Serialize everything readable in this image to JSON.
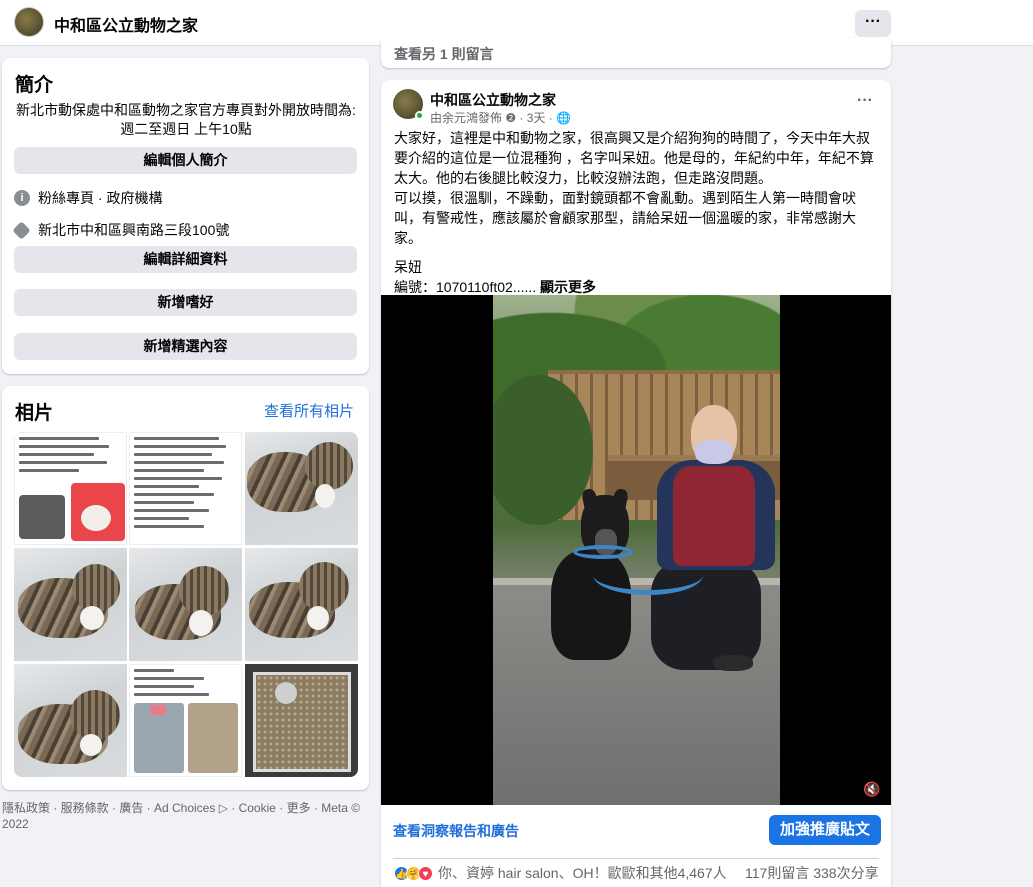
{
  "header": {
    "page_name": "中和區公立動物之家",
    "more_label": "···"
  },
  "intro": {
    "heading": "簡介",
    "description": "新北市動保處中和區動物之家官方專頁對外開放時間為: 週二至週日 上午10點",
    "edit_bio_label": "編輯個人簡介",
    "category": "粉絲專頁 · 政府機構",
    "address": "新北市中和區興南路三段100號",
    "edit_details_label": "編輯詳細資料",
    "add_hobbies_label": "新增嗜好",
    "add_featured_label": "新增精選內容"
  },
  "photos": {
    "heading": "相片",
    "see_all_label": "查看所有相片"
  },
  "footer": {
    "links": "隱私政策 · 服務條款 · 廣告 · Ad Choices ▷ · Cookie · 更多 · Meta © 2022"
  },
  "feed": {
    "prev_comments": "查看另 1 則留言",
    "post": {
      "author": "中和區公立動物之家",
      "meta": "由余元鴻發佈 ❷ · 3天 · 🌐",
      "more_label": "···",
      "paragraph1": "大家好，這裡是中和動物之家，很高興又是介紹狗狗的時間了，今天中年大叔要介紹的這位是一位混種狗 ，名字叫呆妞。他是母的，年紀約中年，年紀不算太大。他的右後腿比較沒力，比較沒辦法跑，但走路沒問題。",
      "paragraph2": "可以摸，很溫馴，不躁動，面對鏡頭都不會亂動。遇到陌生人第一時間會吠叫，有警戒性，應該屬於會顧家那型，請給呆妞一個溫暖的家，非常感謝大家。",
      "name_line": " 呆妞",
      "id_line": "編號：1070110ft02......",
      "show_more": "顯示更多",
      "volume_icon": "🔇",
      "insights_label": "查看洞察報告和廣告",
      "boost_label": "加強推廣貼文",
      "reactions_text": "你、資婷 hair salon、OH！歐歐和其他4,467人",
      "counts_text": "117則留言  338次分享"
    }
  },
  "colors": {
    "brand_blue": "#1b74e4",
    "link_blue": "#216fdb",
    "background": "#f0f2f5"
  }
}
